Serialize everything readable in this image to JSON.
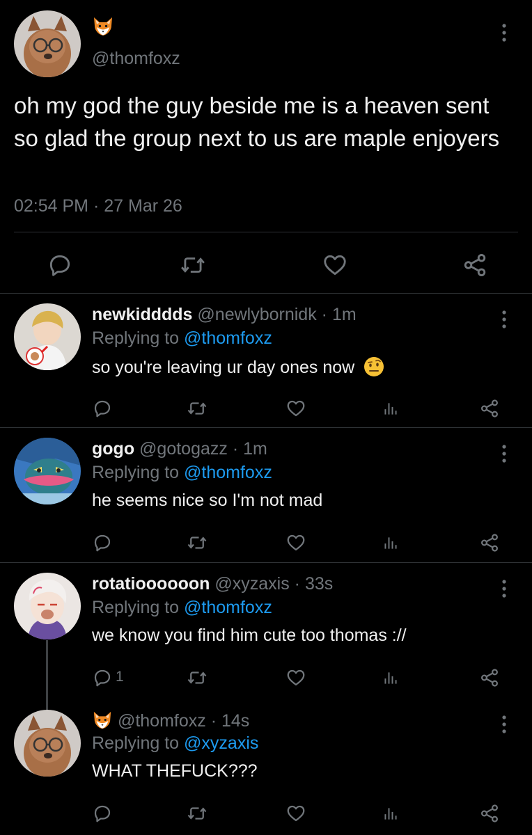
{
  "main_tweet": {
    "handle": "@thomfoxz",
    "text": "oh my god the guy beside me is a heaven sent so glad the group next to us are maple enjoyers",
    "time": "02:54 PM",
    "date": "27 Mar 26",
    "sep": "·"
  },
  "replies": [
    {
      "display_name": "newkidddds",
      "handle": "@newlybornidk",
      "time": "1m",
      "replying_prefix": "Replying to",
      "replying_to": "@thomfoxz",
      "text": "so you're leaving ur day ones now",
      "reply_count": "",
      "avatar_color": "#d9d6d0"
    },
    {
      "display_name": "gogo",
      "handle": "@gotogazz",
      "time": "1m",
      "replying_prefix": "Replying to",
      "replying_to": "@thomfoxz",
      "text": "he seems nice so I'm not mad",
      "reply_count": "",
      "avatar_color": "#2f6fb3"
    },
    {
      "display_name": "rotatioooooon",
      "handle": "@xyzaxis",
      "time": "33s",
      "replying_prefix": "Replying to",
      "replying_to": "@thomfoxz",
      "text": "we know you find him cute too thomas ://",
      "reply_count": "1",
      "avatar_color": "#e9e4e2"
    },
    {
      "display_name": "",
      "handle": "@thomfoxz",
      "time": "14s",
      "replying_prefix": "Replying to",
      "replying_to": "@xyzaxis",
      "text": "WHAT THEFUCK???",
      "reply_count": "",
      "avatar_color": "#b07a4f"
    }
  ],
  "colors": {
    "background": "#000000",
    "text": "#e7e9ea",
    "secondary": "#71767b",
    "link": "#1d9bf0",
    "divider": "#2f3336"
  },
  "icons": [
    "fox-emoji-icon",
    "more-options-icon",
    "reply-icon",
    "retweet-icon",
    "like-icon",
    "views-icon",
    "share-icon",
    "raised-eyebrow-emoji-icon"
  ]
}
